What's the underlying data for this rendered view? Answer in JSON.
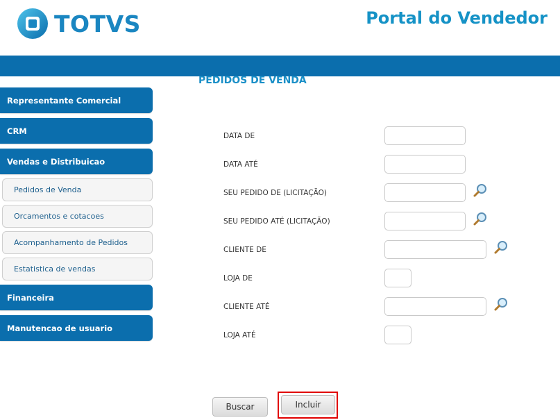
{
  "header": {
    "brand": "TOTVS",
    "portal_title": "Portal do Vendedor"
  },
  "page": {
    "title": "PEDIDOS DE VENDA"
  },
  "sidebar": {
    "items": [
      {
        "label": "Representante Comercial"
      },
      {
        "label": "CRM"
      },
      {
        "label": "Vendas e Distribuicao"
      },
      {
        "label": "Financeira"
      },
      {
        "label": "Manutencao de usuario"
      }
    ],
    "subitems": [
      {
        "label": "Pedidos de Venda"
      },
      {
        "label": "Orcamentos e cotacoes"
      },
      {
        "label": "Acompanhamento de Pedidos"
      },
      {
        "label": "Estatistica de vendas"
      }
    ]
  },
  "form": {
    "fields": [
      {
        "label": "DATA DE",
        "value": ""
      },
      {
        "label": "DATA ATÉ",
        "value": ""
      },
      {
        "label": "SEU PEDIDO DE (LICITAÇÃO)",
        "value": ""
      },
      {
        "label": "SEU PEDIDO ATÉ (LICITAÇÃO)",
        "value": ""
      },
      {
        "label": "CLIENTE DE",
        "value": ""
      },
      {
        "label": "LOJA DE",
        "value": ""
      },
      {
        "label": "CLIENTE ATÉ",
        "value": ""
      },
      {
        "label": "LOJA ATÉ",
        "value": ""
      }
    ]
  },
  "buttons": {
    "buscar": "Buscar",
    "incluir": "Incluir"
  },
  "colors": {
    "brand_blue": "#0b6ead",
    "title_blue": "#1592c6",
    "highlight_red": "#e10000"
  },
  "icons": {
    "lookup": "magnifier-icon",
    "logo": "totvs-logo-icon"
  }
}
